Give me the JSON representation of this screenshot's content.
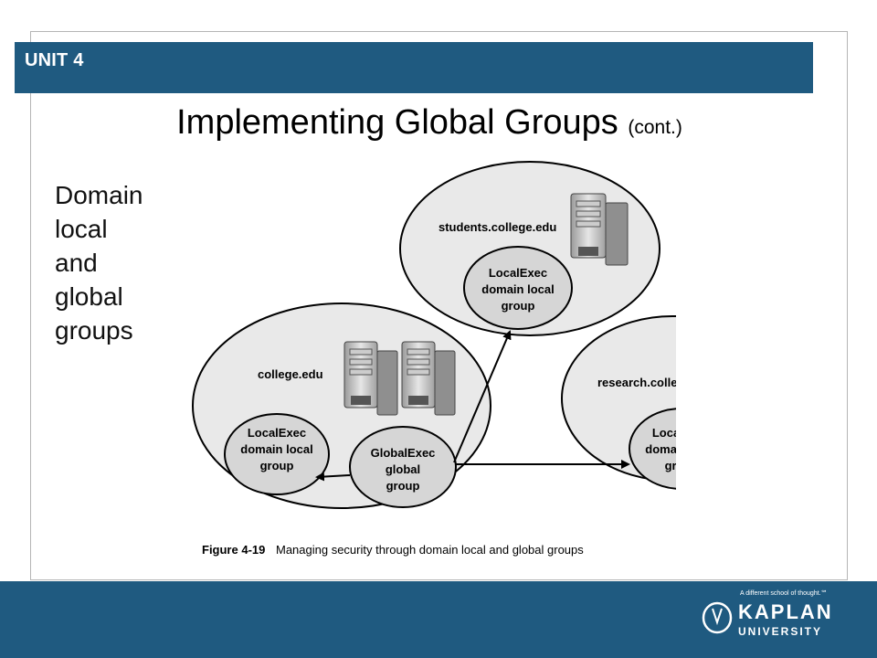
{
  "header": {
    "unit_label": "UNIT 4"
  },
  "title": {
    "main": "Implementing Global Groups",
    "suffix": "(cont.)"
  },
  "side_text": [
    "Domain",
    "local",
    "and",
    "global",
    "groups"
  ],
  "diagram": {
    "domains": {
      "students": "students.college.edu",
      "college": "college.edu",
      "research": "research.college.edu"
    },
    "groups": {
      "students_local": [
        "LocalExec",
        "domain local",
        "group"
      ],
      "college_local": [
        "LocalExec",
        "domain local",
        "group"
      ],
      "college_global": [
        "GlobalExec",
        "global",
        "group"
      ],
      "research_local": [
        "LocalExec",
        "domain local",
        "group"
      ]
    },
    "caption_label": "Figure 4-19",
    "caption_text": "Managing security through domain local and global groups"
  },
  "footer": {
    "tagline": "A different school of thought.℠",
    "logo_line1": "KAPLAN",
    "logo_line2": "UNIVERSITY"
  },
  "colors": {
    "brand_blue": "#1f5a80",
    "domain_fill": "#e9e9e9",
    "group_fill": "#d6d6d6"
  }
}
